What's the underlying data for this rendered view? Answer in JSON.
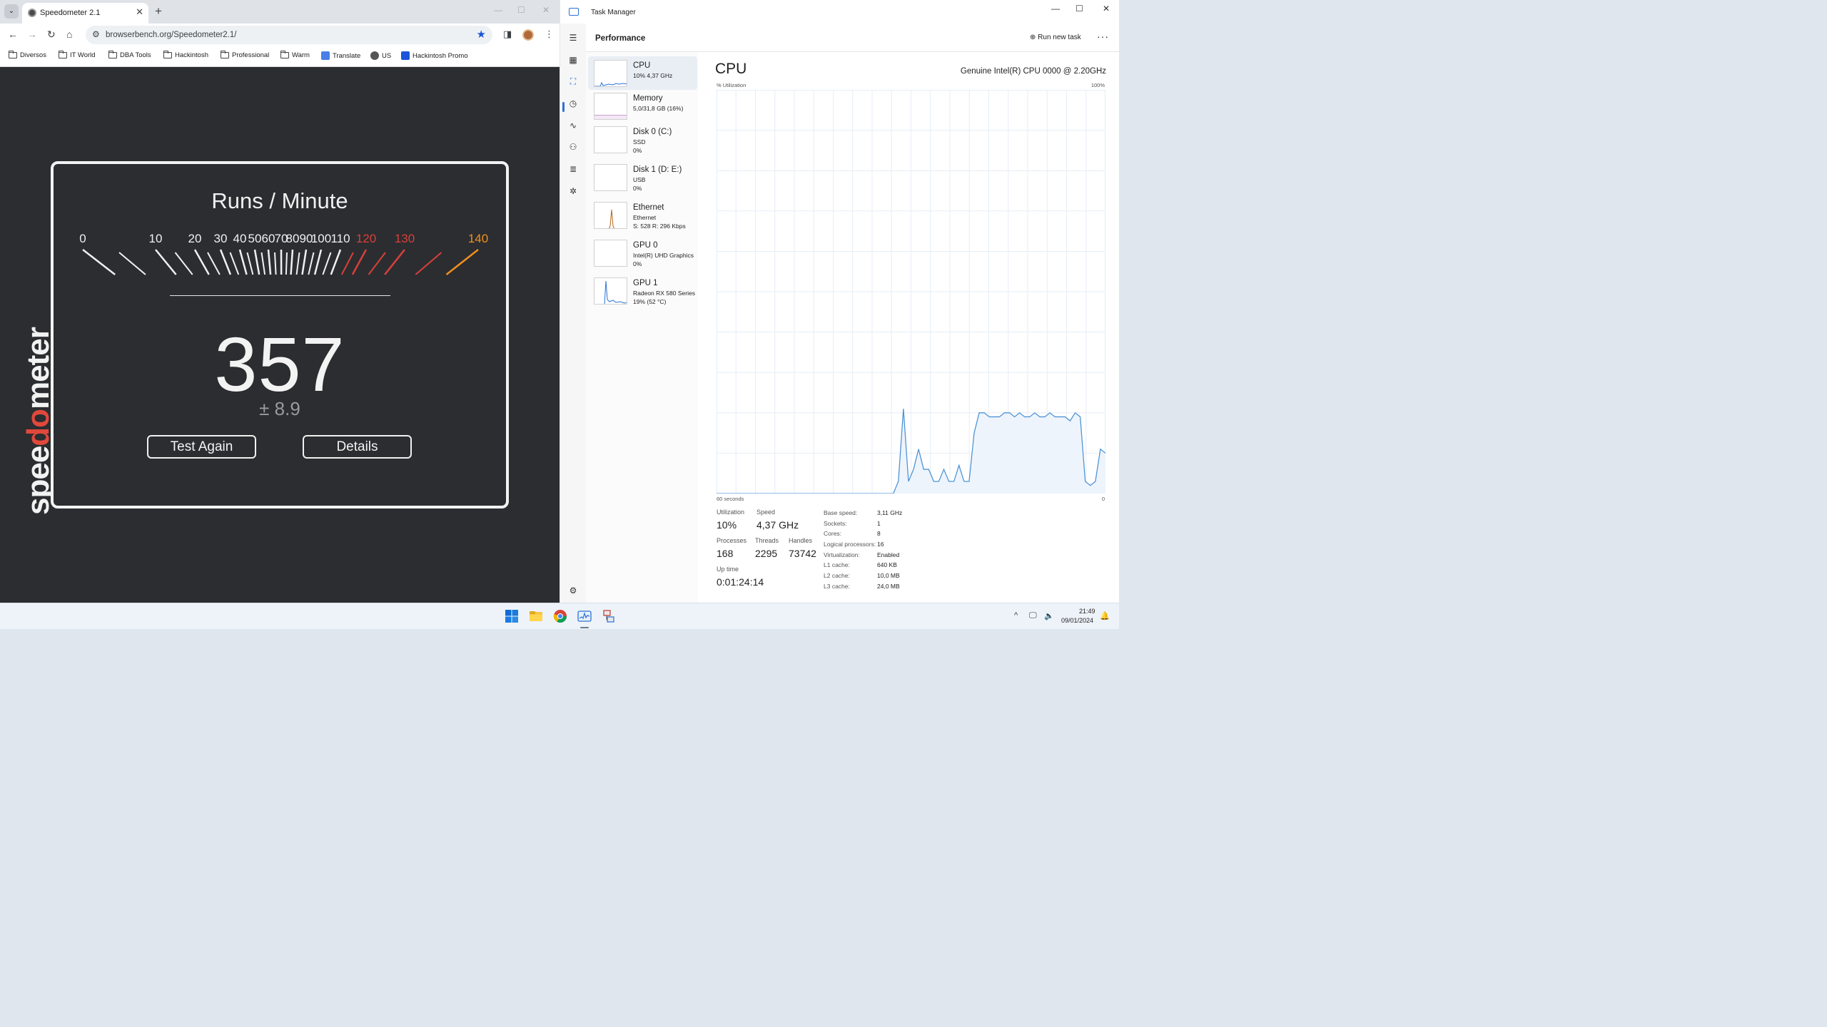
{
  "chrome": {
    "tab_title": "Speedometer 2.1",
    "url": "browserbench.org/Speedometer2.1/",
    "bookmarks": [
      "Diversos",
      "IT World",
      "DBA Tools",
      "Hackintosh",
      "Professional",
      "Warm",
      "Translate",
      "US",
      "Hackintosh Promo"
    ]
  },
  "speedometer": {
    "logo": "speedometer",
    "title": "Runs / Minute",
    "gauge_labels": [
      "0",
      "10",
      "20",
      "30",
      "40",
      "50",
      "60",
      "70",
      "80",
      "90",
      "100",
      "110",
      "120",
      "130",
      "140"
    ],
    "score": "357",
    "margin": "± 8.9",
    "test_again": "Test Again",
    "details": "Details"
  },
  "taskmgr": {
    "title": "Task Manager",
    "section": "Performance",
    "run_new_task": "Run new task",
    "resources": [
      {
        "name": "CPU",
        "d1": "10%  4,37 GHz",
        "d2": ""
      },
      {
        "name": "Memory",
        "d1": "5,0/31,8 GB (16%)",
        "d2": ""
      },
      {
        "name": "Disk 0 (C:)",
        "d1": "SSD",
        "d2": "0%"
      },
      {
        "name": "Disk 1 (D: E:)",
        "d1": "USB",
        "d2": "0%"
      },
      {
        "name": "Ethernet",
        "d1": "Ethernet",
        "d2": "S: 528  R: 296 Kbps"
      },
      {
        "name": "GPU 0",
        "d1": "Intel(R) UHD Graphics",
        "d2": "0%"
      },
      {
        "name": "GPU 1",
        "d1": "Radeon RX 580 Series",
        "d2": "19%  (52 °C)"
      }
    ],
    "cpu_title": "CPU",
    "cpu_model": "Genuine Intel(R) CPU 0000 @ 2.20GHz",
    "util_label": "% Utilization",
    "util_max": "100%",
    "time_label": "60 seconds",
    "time_min": "0",
    "stats": {
      "utilization_label": "Utilization",
      "utilization": "10%",
      "speed_label": "Speed",
      "speed": "4,37 GHz",
      "processes_label": "Processes",
      "processes": "168",
      "threads_label": "Threads",
      "threads": "2295",
      "handles_label": "Handles",
      "handles": "73742",
      "uptime_label": "Up time",
      "uptime": "0:01:24:14"
    },
    "specs": [
      {
        "label": "Base speed:",
        "value": "3,11 GHz"
      },
      {
        "label": "Sockets:",
        "value": "1"
      },
      {
        "label": "Cores:",
        "value": "8"
      },
      {
        "label": "Logical processors:",
        "value": "16"
      },
      {
        "label": "Virtualization:",
        "value": "Enabled"
      },
      {
        "label": "L1 cache:",
        "value": "640 KB"
      },
      {
        "label": "L2 cache:",
        "value": "10,0 MB"
      },
      {
        "label": "L3 cache:",
        "value": "24,0 MB"
      }
    ],
    "cpu_history": [
      0,
      0,
      0,
      0,
      0,
      0,
      0,
      0,
      0,
      0,
      0,
      0,
      0,
      0,
      0,
      0,
      0,
      0,
      0,
      0,
      0,
      0,
      0,
      0,
      0,
      0,
      0,
      0,
      0,
      0,
      0,
      0,
      0,
      0,
      0,
      0,
      0,
      2,
      3,
      3,
      21,
      6,
      4,
      6,
      8,
      8,
      6,
      6,
      3,
      6,
      10,
      15,
      8,
      5,
      8,
      7,
      6,
      4,
      5,
      8,
      5,
      3,
      6,
      12,
      15,
      12,
      8,
      4,
      2,
      2,
      1,
      4,
      5,
      3,
      4,
      3,
      3,
      4,
      4,
      6,
      4,
      6,
      6,
      4,
      4,
      2,
      4,
      7,
      8,
      6,
      2,
      6,
      16,
      20,
      26,
      24,
      12,
      7,
      4,
      6,
      8,
      6,
      3,
      5,
      3,
      0,
      3,
      6,
      13,
      12,
      3,
      2,
      3,
      5,
      3,
      2,
      3,
      1,
      2,
      4,
      5,
      5,
      3,
      2,
      5,
      2,
      8,
      6,
      4,
      3,
      2,
      4,
      3,
      1,
      4,
      5,
      5,
      3,
      3,
      3,
      3,
      3,
      3,
      3,
      3,
      3,
      3,
      3,
      3,
      3,
      3,
      3,
      3,
      3,
      3,
      3,
      3,
      2,
      3,
      3,
      3,
      3,
      3,
      3,
      3,
      3,
      3,
      3,
      3,
      3,
      3,
      3,
      3,
      3,
      3,
      3,
      3,
      3,
      3,
      2
    ],
    "cpu_series": [
      0,
      0,
      0,
      0,
      0,
      0,
      0,
      0,
      0,
      0,
      0,
      0,
      0,
      0,
      0,
      0,
      0,
      0,
      0,
      0,
      0,
      0,
      0,
      0,
      0,
      0,
      0,
      0,
      0,
      0,
      0,
      0,
      0,
      0,
      0,
      0,
      3,
      21,
      3,
      6,
      11,
      6,
      6,
      3,
      3,
      6,
      3,
      3,
      7,
      3,
      3,
      15,
      20,
      20,
      19,
      19,
      19,
      20,
      20,
      19,
      20,
      19,
      19,
      20,
      19,
      19,
      20,
      19,
      19,
      19,
      18,
      20,
      19,
      3,
      2,
      3,
      11,
      10
    ],
    "cpu_series_note": "",
    "accent": "#2b72d7"
  },
  "taskbar": {
    "time": "21:49",
    "date": "09/01/2024"
  }
}
